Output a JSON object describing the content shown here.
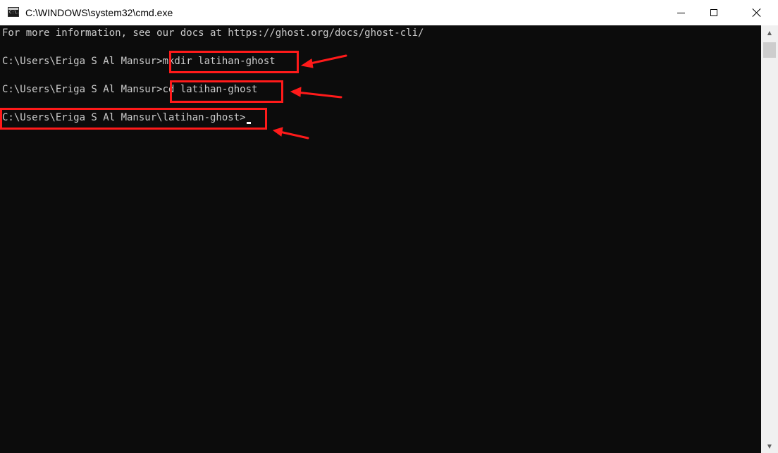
{
  "window": {
    "title": "C:\\WINDOWS\\system32\\cmd.exe",
    "icon": "cmd-icon",
    "icon_text": "C:\\."
  },
  "titlebar_buttons": {
    "minimize": "minimize-icon",
    "maximize": "maximize-icon",
    "close": "close-icon"
  },
  "console": {
    "lines": [
      "For more information, see our docs at https://ghost.org/docs/ghost-cli/",
      "C:\\Users\\Eriga S Al Mansur>mkdir latihan-ghost",
      "C:\\Users\\Eriga S Al Mansur>cd latihan-ghost",
      "C:\\Users\\Eriga S Al Mansur\\latihan-ghost>"
    ]
  },
  "scrollbar": {
    "up": "▲",
    "down": "▼"
  },
  "colors": {
    "console_bg": "#0c0c0c",
    "console_fg": "#cccccc",
    "highlight": "#ff1a1a",
    "titlebar_bg": "#ffffff"
  }
}
